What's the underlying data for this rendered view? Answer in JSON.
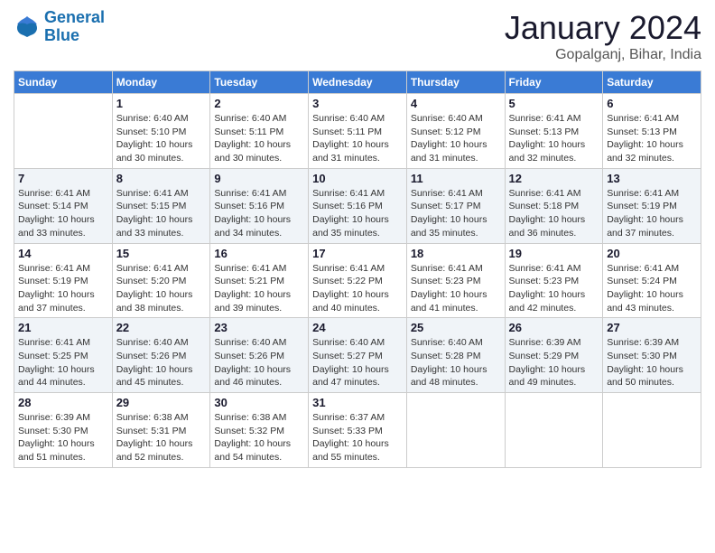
{
  "logo": {
    "line1": "General",
    "line2": "Blue"
  },
  "header": {
    "month_title": "January 2024",
    "subtitle": "Gopalganj, Bihar, India"
  },
  "days_of_week": [
    "Sunday",
    "Monday",
    "Tuesday",
    "Wednesday",
    "Thursday",
    "Friday",
    "Saturday"
  ],
  "weeks": [
    [
      {
        "day": "",
        "info": ""
      },
      {
        "day": "1",
        "info": "Sunrise: 6:40 AM\nSunset: 5:10 PM\nDaylight: 10 hours\nand 30 minutes."
      },
      {
        "day": "2",
        "info": "Sunrise: 6:40 AM\nSunset: 5:11 PM\nDaylight: 10 hours\nand 30 minutes."
      },
      {
        "day": "3",
        "info": "Sunrise: 6:40 AM\nSunset: 5:11 PM\nDaylight: 10 hours\nand 31 minutes."
      },
      {
        "day": "4",
        "info": "Sunrise: 6:40 AM\nSunset: 5:12 PM\nDaylight: 10 hours\nand 31 minutes."
      },
      {
        "day": "5",
        "info": "Sunrise: 6:41 AM\nSunset: 5:13 PM\nDaylight: 10 hours\nand 32 minutes."
      },
      {
        "day": "6",
        "info": "Sunrise: 6:41 AM\nSunset: 5:13 PM\nDaylight: 10 hours\nand 32 minutes."
      }
    ],
    [
      {
        "day": "7",
        "info": "Sunrise: 6:41 AM\nSunset: 5:14 PM\nDaylight: 10 hours\nand 33 minutes."
      },
      {
        "day": "8",
        "info": "Sunrise: 6:41 AM\nSunset: 5:15 PM\nDaylight: 10 hours\nand 33 minutes."
      },
      {
        "day": "9",
        "info": "Sunrise: 6:41 AM\nSunset: 5:16 PM\nDaylight: 10 hours\nand 34 minutes."
      },
      {
        "day": "10",
        "info": "Sunrise: 6:41 AM\nSunset: 5:16 PM\nDaylight: 10 hours\nand 35 minutes."
      },
      {
        "day": "11",
        "info": "Sunrise: 6:41 AM\nSunset: 5:17 PM\nDaylight: 10 hours\nand 35 minutes."
      },
      {
        "day": "12",
        "info": "Sunrise: 6:41 AM\nSunset: 5:18 PM\nDaylight: 10 hours\nand 36 minutes."
      },
      {
        "day": "13",
        "info": "Sunrise: 6:41 AM\nSunset: 5:19 PM\nDaylight: 10 hours\nand 37 minutes."
      }
    ],
    [
      {
        "day": "14",
        "info": "Sunrise: 6:41 AM\nSunset: 5:19 PM\nDaylight: 10 hours\nand 37 minutes."
      },
      {
        "day": "15",
        "info": "Sunrise: 6:41 AM\nSunset: 5:20 PM\nDaylight: 10 hours\nand 38 minutes."
      },
      {
        "day": "16",
        "info": "Sunrise: 6:41 AM\nSunset: 5:21 PM\nDaylight: 10 hours\nand 39 minutes."
      },
      {
        "day": "17",
        "info": "Sunrise: 6:41 AM\nSunset: 5:22 PM\nDaylight: 10 hours\nand 40 minutes."
      },
      {
        "day": "18",
        "info": "Sunrise: 6:41 AM\nSunset: 5:23 PM\nDaylight: 10 hours\nand 41 minutes."
      },
      {
        "day": "19",
        "info": "Sunrise: 6:41 AM\nSunset: 5:23 PM\nDaylight: 10 hours\nand 42 minutes."
      },
      {
        "day": "20",
        "info": "Sunrise: 6:41 AM\nSunset: 5:24 PM\nDaylight: 10 hours\nand 43 minutes."
      }
    ],
    [
      {
        "day": "21",
        "info": "Sunrise: 6:41 AM\nSunset: 5:25 PM\nDaylight: 10 hours\nand 44 minutes."
      },
      {
        "day": "22",
        "info": "Sunrise: 6:40 AM\nSunset: 5:26 PM\nDaylight: 10 hours\nand 45 minutes."
      },
      {
        "day": "23",
        "info": "Sunrise: 6:40 AM\nSunset: 5:26 PM\nDaylight: 10 hours\nand 46 minutes."
      },
      {
        "day": "24",
        "info": "Sunrise: 6:40 AM\nSunset: 5:27 PM\nDaylight: 10 hours\nand 47 minutes."
      },
      {
        "day": "25",
        "info": "Sunrise: 6:40 AM\nSunset: 5:28 PM\nDaylight: 10 hours\nand 48 minutes."
      },
      {
        "day": "26",
        "info": "Sunrise: 6:39 AM\nSunset: 5:29 PM\nDaylight: 10 hours\nand 49 minutes."
      },
      {
        "day": "27",
        "info": "Sunrise: 6:39 AM\nSunset: 5:30 PM\nDaylight: 10 hours\nand 50 minutes."
      }
    ],
    [
      {
        "day": "28",
        "info": "Sunrise: 6:39 AM\nSunset: 5:30 PM\nDaylight: 10 hours\nand 51 minutes."
      },
      {
        "day": "29",
        "info": "Sunrise: 6:38 AM\nSunset: 5:31 PM\nDaylight: 10 hours\nand 52 minutes."
      },
      {
        "day": "30",
        "info": "Sunrise: 6:38 AM\nSunset: 5:32 PM\nDaylight: 10 hours\nand 54 minutes."
      },
      {
        "day": "31",
        "info": "Sunrise: 6:37 AM\nSunset: 5:33 PM\nDaylight: 10 hours\nand 55 minutes."
      },
      {
        "day": "",
        "info": ""
      },
      {
        "day": "",
        "info": ""
      },
      {
        "day": "",
        "info": ""
      }
    ]
  ]
}
